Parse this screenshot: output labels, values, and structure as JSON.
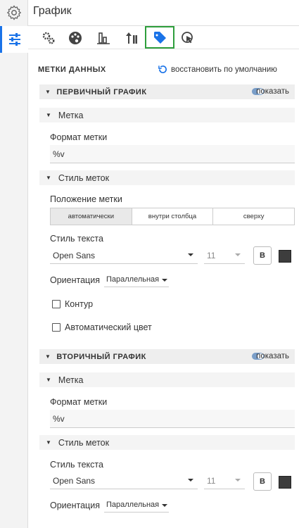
{
  "header": {
    "title": "График"
  },
  "toolbar": {
    "tabs": [
      "settings-gears",
      "palette",
      "bar-chart",
      "sort-arrows",
      "tag",
      "cursor-click"
    ],
    "selected": "tag"
  },
  "data_labels": {
    "heading": "МЕТКИ ДАННЫХ",
    "restore_label": "восстановить по умолчанию"
  },
  "primary": {
    "title": "ПЕРВИЧНЫЙ ГРАФИК",
    "show_label": "показать",
    "label_section": "Метка",
    "format_label": "Формат метки",
    "format_value": "%v",
    "style_section": "Стиль меток",
    "position_label": "Положение метки",
    "position_options": [
      "автоматически",
      "внутри столбца",
      "сверху"
    ],
    "position_selected": "автоматически",
    "text_style_label": "Стиль текста",
    "font": "Open Sans",
    "size": "11",
    "bold": "B",
    "orientation_label": "Ориентация",
    "orientation_value": "Параллельная",
    "outline_label": "Контур",
    "autocolor_label": "Автоматический цвет"
  },
  "secondary": {
    "title": "ВТОРИЧНЫЙ ГРАФИК",
    "show_label": "показать",
    "label_section": "Метка",
    "format_label": "Формат метки",
    "format_value": "%v",
    "style_section": "Стиль меток",
    "text_style_label": "Стиль текста",
    "font": "Open Sans",
    "size": "11",
    "bold": "B",
    "orientation_label": "Ориентация",
    "orientation_value": "Параллельная"
  },
  "colors": {
    "accent": "#1a73e8",
    "selected_border": "#2e9e3c",
    "swatch": "#3d3d3d"
  }
}
